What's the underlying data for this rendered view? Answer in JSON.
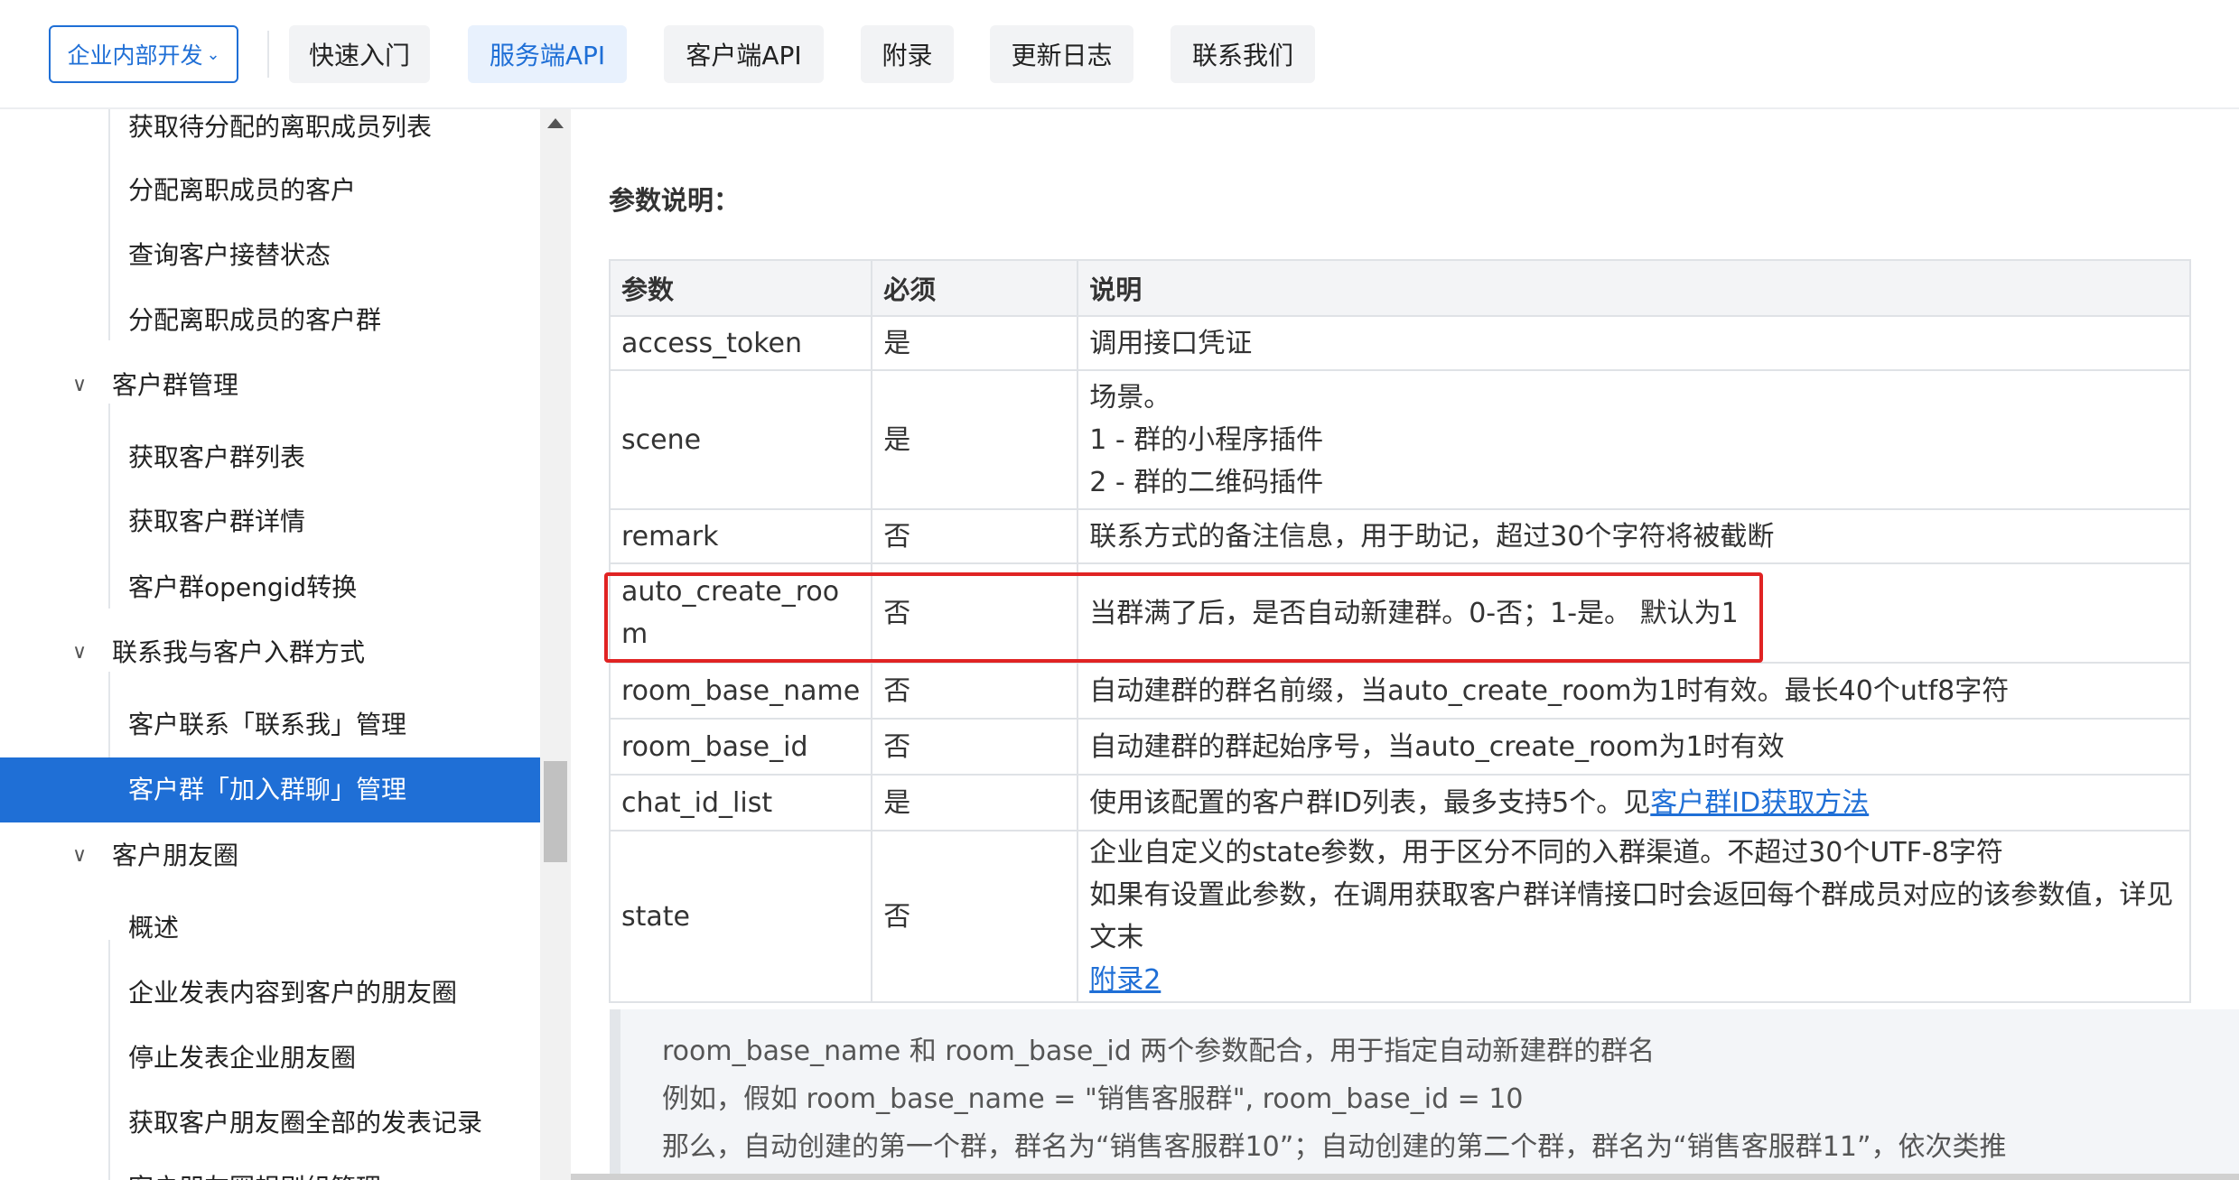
{
  "nav": {
    "dropdown_label": "企业内部开发",
    "tabs": [
      {
        "label": "快速入门",
        "active": false
      },
      {
        "label": "服务端API",
        "active": true
      },
      {
        "label": "客户端API",
        "active": false
      },
      {
        "label": "附录",
        "active": false
      },
      {
        "label": "更新日志",
        "active": false
      },
      {
        "label": "联系我们",
        "active": false
      }
    ]
  },
  "sidebar": {
    "items": [
      {
        "label": "获取待分配的离职成员列表"
      },
      {
        "label": "分配离职成员的客户"
      },
      {
        "label": "查询客户接替状态"
      },
      {
        "label": "分配离职成员的客户群"
      },
      {
        "label": "客户群管理"
      },
      {
        "label": "获取客户群列表"
      },
      {
        "label": "获取客户群详情"
      },
      {
        "label": "客户群opengid转换"
      },
      {
        "label": "联系我与客户入群方式"
      },
      {
        "label": "客户联系「联系我」管理"
      },
      {
        "label": "客户群「加入群聊」管理"
      },
      {
        "label": "客户朋友圈"
      },
      {
        "label": "概述"
      },
      {
        "label": "企业发表内容到客户的朋友圈"
      },
      {
        "label": "停止发表企业朋友圈"
      },
      {
        "label": "获取客户朋友圈全部的发表记录"
      },
      {
        "label": "客户朋友圈规则组管理"
      }
    ],
    "active_index": 10
  },
  "content": {
    "section_title": "参数说明：",
    "table": {
      "headers": [
        "参数",
        "必须",
        "说明"
      ],
      "rows": [
        {
          "param": "access_token",
          "required": "是",
          "desc": [
            "调用接口凭证"
          ]
        },
        {
          "param": "scene",
          "required": "是",
          "desc": [
            "场景。",
            "1 - 群的小程序插件",
            "2 - 群的二维码插件"
          ]
        },
        {
          "param": "remark",
          "required": "否",
          "desc": [
            "联系方式的备注信息，用于助记，超过30个字符将被截断"
          ]
        },
        {
          "param_lines": [
            "auto_create_roo",
            "m"
          ],
          "required": "否",
          "desc": [
            "当群满了后，是否自动新建群。0-否；1-是。 默认为1"
          ],
          "highlighted": true
        },
        {
          "param": "room_base_name",
          "required": "否",
          "desc": [
            "自动建群的群名前缀，当auto_create_room为1时有效。最长40个utf8字符"
          ]
        },
        {
          "param": "room_base_id",
          "required": "否",
          "desc": [
            "自动建群的群起始序号，当auto_create_room为1时有效"
          ]
        },
        {
          "param": "chat_id_list",
          "required": "是",
          "desc_prefix": "使用该配置的客户群ID列表，最多支持5个。见",
          "desc_link": "客户群ID获取方法"
        },
        {
          "param": "state",
          "required": "否",
          "desc": [
            "企业自定义的state参数，用于区分不同的入群渠道。不超过30个UTF-8字符",
            "如果有设置此参数，在调用获取客户群详情接口时会返回每个群成员对应的该参数值，详见文末"
          ],
          "desc_link": "附录2"
        }
      ]
    },
    "note": [
      "room_base_name 和 room_base_id 两个参数配合，用于指定自动新建群的群名",
      "例如，假如 room_base_name = \"销售客服群\", room_base_id = 10",
      "那么，自动创建的第一个群，群名为“销售客服群10”；自动创建的第二个群，群名为“销售客服群11”，依次类推"
    ]
  },
  "colors": {
    "accent": "#1f6fd6",
    "highlight_border": "#e02323",
    "active_tab_bg": "#e8f1fd"
  }
}
